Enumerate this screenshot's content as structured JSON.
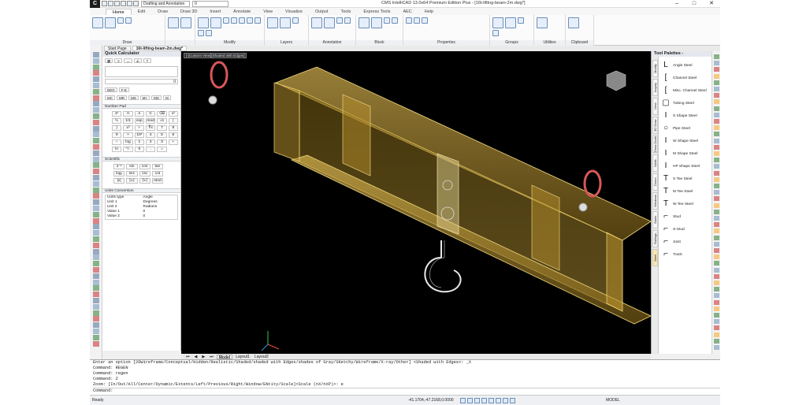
{
  "titlebar": {
    "logo": "C",
    "workspace": "Drafting and Annotation",
    "layer": "0",
    "title": "CMS IntelliCAD 13.0x64 Premium Edition Plus - [16t-lifting-beam-2m.dwg*]",
    "min": "–",
    "max": "□",
    "close": "✕"
  },
  "tabs": [
    "Home",
    "Edit",
    "Draw",
    "Draw 3D",
    "Insert",
    "Annotate",
    "View",
    "Visualize",
    "Output",
    "Tools",
    "Express Tools",
    "AEC",
    "Help"
  ],
  "ribbon": {
    "groups": [
      {
        "label": "Draw",
        "items": [
          "Line",
          "Polyline",
          "Circle",
          "Arc"
        ]
      },
      {
        "label": "",
        "items": [
          "Move",
          "3D Positioner"
        ]
      },
      {
        "label": "Modify",
        "items": [
          "Copy",
          "Rotate",
          "Trim",
          "Clone",
          "Mirror",
          "Fillet",
          "Stretch",
          "Scale",
          "Rectangular Array"
        ]
      },
      {
        "label": "Layers",
        "items": [
          "Explore Layers",
          "Layer Match",
          "Layer Delete"
        ]
      },
      {
        "label": "Annotation",
        "items": [
          "Text",
          "Linear",
          "Center Point",
          "Multileader"
        ]
      },
      {
        "label": "Block",
        "items": [
          "Insert Block",
          "Edit Attributes",
          "Create Block",
          "Block Editor"
        ]
      },
      {
        "label": "Properties",
        "items": [
          "BYLAYER",
          "BYLAYER",
          "BYLAYER"
        ]
      },
      {
        "label": "Groups",
        "items": [
          "Group Manager",
          "Quick Group",
          "Ungroup",
          "Group Edit"
        ]
      },
      {
        "label": "Utilities",
        "items": [
          "Measure"
        ]
      },
      {
        "label": "Clipboard",
        "items": [
          "Paste"
        ]
      }
    ]
  },
  "doctabs": [
    "Start Page",
    "16t-lifting-beam-2m.dwg*"
  ],
  "calculator": {
    "title": "Quick Calculator",
    "display": "0",
    "modes": [
      "DEG",
      "F-E"
    ],
    "memory": [
      "MC",
      "MR",
      "MS",
      "M+",
      "MS",
      "M"
    ],
    "numberpad_label": "Number Pad",
    "keys": [
      "2ⁿ",
      "π",
      "e",
      "C",
      "⌫",
      "x²",
      "½",
      "1/1",
      "exp",
      "mod",
      "√x",
      "(",
      ")",
      "x³",
      "+",
      "∛x",
      "7",
      "8",
      "9",
      "×",
      "10ˣ",
      "4",
      "5",
      "6",
      "−",
      "log",
      "1",
      "2",
      "3",
      "+",
      "ln",
      "⁺/₋",
      "0",
      ".",
      "="
    ],
    "scientific_label": "Scientific",
    "sci": [
      "2⁻ˣ",
      "sin",
      "cos",
      "tan",
      "logₓ",
      "sec",
      "csc",
      "cot",
      "|x|",
      "⌊x⌋",
      "⌈x⌉",
      "rand"
    ],
    "units_label": "Units Conversion",
    "units": [
      [
        "Units type",
        "Angle"
      ],
      [
        "Unit 1",
        "Degrees"
      ],
      [
        "Unit 2",
        "Radians"
      ],
      [
        "Value 1",
        "0"
      ],
      [
        "Value 2",
        "0"
      ]
    ]
  },
  "viewport": {
    "label": "[-]Custom View][Shaded with Edges]",
    "ucs": "Y"
  },
  "layout_tabs": [
    "Model",
    "Layout1",
    "Layout2"
  ],
  "toolpalette": {
    "title": "Tool Palettes -",
    "side_tabs": [
      "Modify",
      "Inquiry",
      "View",
      "3D Draw",
      "Draw Dode",
      "Walls",
      "Doors",
      "Windows",
      "Stairs",
      "Railings",
      "Steel"
    ],
    "items": [
      "Angle Steel",
      "Channel Steel",
      "Misc. Channel Steel",
      "Tubing Steel",
      "S Shape Steel",
      "Pipe Steel",
      "W Shape Steel",
      "M Shape Steel",
      "HP Shape Steel",
      "S Tee Steel",
      "M Tee Steel",
      "W Tee Steel",
      "Stud",
      "S-Stud",
      "Joist",
      "Track"
    ]
  },
  "command": [
    "Enter an option [2DWireframe/Conceptual/Hidden/Realistic/Shaded/shaded with Edges/shades of Gray/SKetchy/Wireframe/X-ray/Other] <Shaded with Edges>: _X",
    "Command: REGEN",
    "Command: regen",
    "Command: Z",
    "Zoom:  [In/Out/All/Center/Dynamic/Extents/Left/Previous/Right/Window/ENtity/Scale]<Scale (nX/nXP)>: e"
  ],
  "command_prompt": "Command:",
  "status": {
    "ready": "Ready",
    "coords": "-41.1704,-47.2168,0.0000",
    "model": "MODEL",
    "icons": [
      "snap",
      "grid",
      "ortho",
      "polar",
      "osnap",
      "otrack",
      "lwt",
      "model"
    ]
  },
  "colors": {
    "beam": "#c9a53c",
    "edges": "#f0d878",
    "shackle": "#d8575a"
  }
}
